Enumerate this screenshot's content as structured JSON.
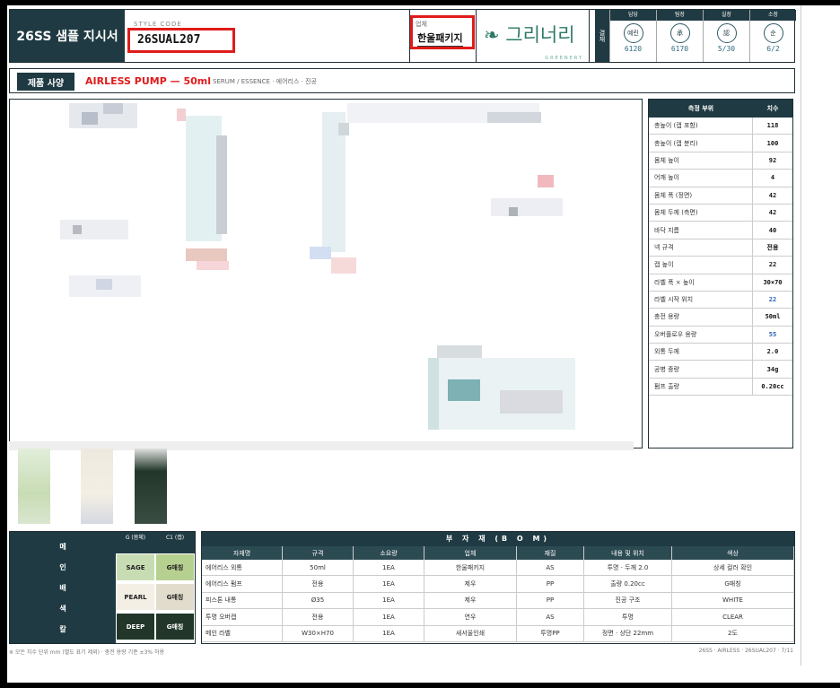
{
  "header": {
    "title": "26SS 샘플 지시서",
    "style_label": "STYLE CODE",
    "style_code": "26SUAL207",
    "vendor_label": "업체",
    "vendor_name": "한울패키지",
    "brand_logo": "❧ 그리너리",
    "brand_sub": "GREENERY"
  },
  "approval": {
    "side_label": "결재",
    "columns": [
      {
        "role": "담당",
        "stamp": "예린",
        "date": "6120"
      },
      {
        "role": "팀장",
        "stamp": "承",
        "date": "6170"
      },
      {
        "role": "실장",
        "stamp": "認",
        "date": "5/30"
      },
      {
        "role": "소장",
        "stamp": "순",
        "date": "6/2"
      }
    ]
  },
  "spec": {
    "tag": "제품 사양",
    "main": "AIRLESS PUMP — 50ml",
    "sub": "SERUM / ESSENCE · 에어리스 · 진공"
  },
  "measure": {
    "head_name": "측정 부위",
    "head_val": "치수",
    "rows": [
      {
        "name": "총높이 (캡 포함)",
        "val": "118",
        "blue": false
      },
      {
        "name": "총높이 (캡 분리)",
        "val": "100",
        "blue": false
      },
      {
        "name": "몸체 높이",
        "val": "92",
        "blue": false
      },
      {
        "name": "어깨 높이",
        "val": "4",
        "blue": false
      },
      {
        "name": "몸체 폭 (정면)",
        "val": "42",
        "blue": false
      },
      {
        "name": "몸체 두께 (측면)",
        "val": "42",
        "blue": false
      },
      {
        "name": "바닥 지름",
        "val": "40",
        "blue": false
      },
      {
        "name": "넥 규격",
        "val": "전용",
        "blue": false
      },
      {
        "name": "캡 높이",
        "val": "22",
        "blue": false
      },
      {
        "name": "라벨 폭 × 높이",
        "val": "30×70",
        "blue": false
      },
      {
        "name": "라벨 시작 위치",
        "val": "22",
        "blue": true
      },
      {
        "name": "충전 용량",
        "val": "50ml",
        "blue": false
      },
      {
        "name": "오버플로우 용량",
        "val": "55",
        "blue": true
      },
      {
        "name": "외통 두께",
        "val": "2.0",
        "blue": false
      },
      {
        "name": "공병 중량",
        "val": "34g",
        "blue": false
      },
      {
        "name": "펌프 출량",
        "val": "0.20cc",
        "blue": false
      }
    ]
  },
  "colors": {
    "head_g": "G\n(몸체)",
    "head_c1": "C1\n(캡)",
    "side": [
      "메",
      "인",
      "배",
      "색",
      "칼",
      "라"
    ],
    "rows": [
      {
        "g": "SAGE",
        "c1": "G매칭",
        "g_bg": "#c8dcb4",
        "c1_bg": "#b6d08f",
        "g_fg": "#222",
        "c1_fg": "#222"
      },
      {
        "g": "PEARL",
        "c1": "G매칭",
        "g_bg": "#f3efe4",
        "c1_bg": "#e2dccc",
        "g_fg": "#222",
        "c1_fg": "#222"
      },
      {
        "g": "DEEP",
        "c1": "G매칭",
        "g_bg": "#22372a",
        "c1_bg": "#22372a",
        "g_fg": "#fff",
        "c1_fg": "#fff"
      }
    ]
  },
  "bom": {
    "title": "부 자 재 (B O M)",
    "headers": [
      "자재명",
      "규격",
      "소요량",
      "업체",
      "재질",
      "내용 및 위치",
      "색상"
    ],
    "rows": [
      [
        "에어리스 외통",
        "50ml",
        "1EA",
        "한울패키지",
        "AS",
        "투명 · 두께 2.0",
        "상세 컬러 확인"
      ],
      [
        "에어리스 펌프",
        "전용",
        "1EA",
        "제우",
        "PP",
        "출량 0.20cc",
        "G매칭"
      ],
      [
        "피스톤 내통",
        "Ø35",
        "1EA",
        "제우",
        "PP",
        "진공 구조",
        "WHITE"
      ],
      [
        "투명 오버캡",
        "전용",
        "1EA",
        "연우",
        "AS",
        "투명",
        "CLEAR"
      ],
      [
        "메인 라벨",
        "W30×H70",
        "1EA",
        "새서울인쇄",
        "투명PP",
        "정면 · 상단 22mm",
        "2도"
      ]
    ]
  },
  "footer": {
    "note": "※ 모든 치수 단위 mm (별도 표기 제외) · 충전 용량 기준 ±3% 허용",
    "page": "26SS · AIRLESS · 26SUAL207 · 7/11"
  }
}
